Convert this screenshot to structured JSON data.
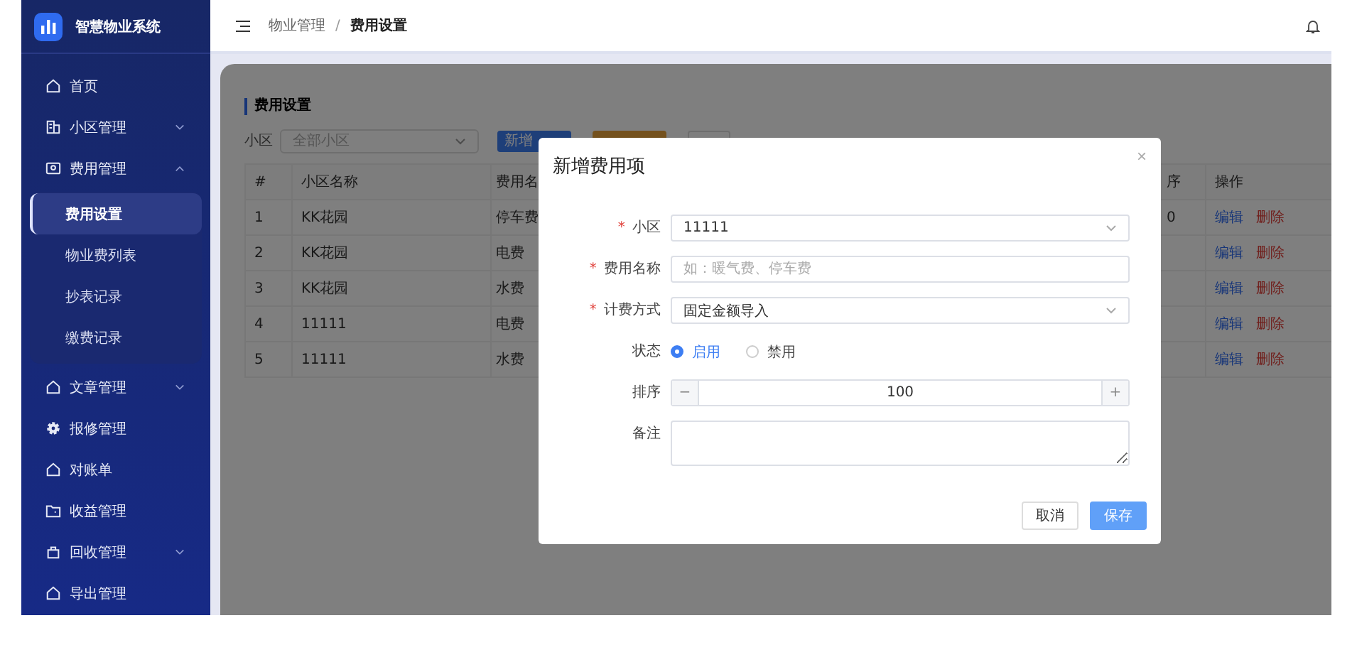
{
  "app": {
    "title": "智慧物业系统"
  },
  "sidebar": {
    "items": [
      {
        "label": "首页",
        "kind": "link"
      },
      {
        "label": "小区管理",
        "kind": "group",
        "expanded": false
      },
      {
        "label": "费用管理",
        "kind": "group",
        "expanded": true,
        "children": [
          {
            "label": "费用设置",
            "selected": true
          },
          {
            "label": "物业费列表",
            "selected": false
          },
          {
            "label": "抄表记录",
            "selected": false
          },
          {
            "label": "缴费记录",
            "selected": false
          }
        ]
      },
      {
        "label": "文章管理",
        "kind": "group",
        "expanded": false
      },
      {
        "label": "报修管理",
        "kind": "link"
      },
      {
        "label": "对账单",
        "kind": "link"
      },
      {
        "label": "收益管理",
        "kind": "link"
      },
      {
        "label": "回收管理",
        "kind": "group",
        "expanded": false
      },
      {
        "label": "导出管理",
        "kind": "link"
      }
    ]
  },
  "header": {
    "breadcrumb": [
      "物业管理",
      "费用设置"
    ],
    "separator": "/"
  },
  "page": {
    "title": "费用设置",
    "filter": {
      "label": "小区",
      "placeholder": "全部小区"
    },
    "buttons": [
      {
        "label": "新增",
        "kind": "primary"
      },
      {
        "kind": "warning"
      },
      {
        "kind": "default"
      }
    ],
    "table": {
      "columns": [
        "#",
        "小区名称",
        "费用名",
        "序",
        "操作"
      ],
      "rows": [
        {
          "index": "1",
          "community": "KK花园",
          "fee": "停车费",
          "order": "0",
          "actions": [
            "编辑",
            "删除"
          ]
        },
        {
          "index": "2",
          "community": "KK花园",
          "fee": "电费",
          "actions": [
            "编辑",
            "删除"
          ]
        },
        {
          "index": "3",
          "community": "KK花园",
          "fee": "水费",
          "actions": [
            "编辑",
            "删除"
          ]
        },
        {
          "index": "4",
          "community": "11111",
          "fee": "电费",
          "actions": [
            "编辑",
            "删除"
          ]
        },
        {
          "index": "5",
          "community": "11111",
          "fee": "水费",
          "actions": [
            "编辑",
            "删除"
          ]
        }
      ]
    }
  },
  "dialog": {
    "title": "新增费用项",
    "close": "×",
    "fields": [
      {
        "kind": "select",
        "label": "小区",
        "required_mark": "*",
        "value": "11111"
      },
      {
        "kind": "input",
        "label": "费用名称",
        "required_mark": "*",
        "placeholder": "如：暖气费、停车费"
      },
      {
        "kind": "select",
        "label": "计费方式",
        "required_mark": "*",
        "value": "固定金额导入"
      },
      {
        "kind": "radio",
        "label": "状态",
        "options": [
          {
            "label": "启用",
            "selected": true
          },
          {
            "label": "禁用",
            "selected": false
          }
        ]
      },
      {
        "kind": "stepper",
        "label": "排序",
        "value": "100",
        "minus": "−",
        "plus": "+"
      },
      {
        "kind": "textarea",
        "label": "备注"
      }
    ],
    "buttons": [
      {
        "label": "取消",
        "kind": "default"
      },
      {
        "label": "保存",
        "kind": "primary"
      }
    ]
  }
}
